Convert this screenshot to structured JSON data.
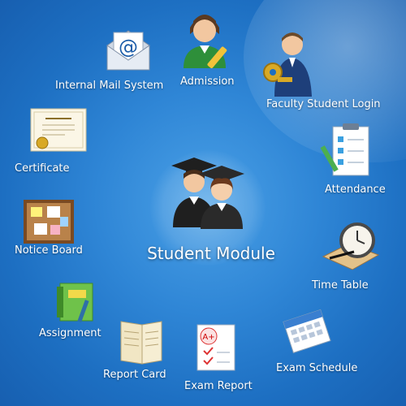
{
  "center": {
    "label": "Student Module",
    "icon": "graduates-icon"
  },
  "modules": [
    {
      "id": "mail",
      "label": "Internal Mail System",
      "icon": "mail-icon"
    },
    {
      "id": "admission",
      "label": "Admission",
      "icon": "student-pencil-icon"
    },
    {
      "id": "faculty",
      "label": "Faculty Student Login",
      "icon": "key-person-icon"
    },
    {
      "id": "certificate",
      "label": "Certificate",
      "icon": "certificate-icon"
    },
    {
      "id": "attendance",
      "label": "Attendance",
      "icon": "checklist-icon"
    },
    {
      "id": "notice",
      "label": "Notice Board",
      "icon": "corkboard-icon"
    },
    {
      "id": "timetable",
      "label": "Time Table",
      "icon": "clock-book-icon"
    },
    {
      "id": "assignment",
      "label": "Assignment",
      "icon": "notebook-icon"
    },
    {
      "id": "reportcard",
      "label": "Report Card",
      "icon": "report-card-icon"
    },
    {
      "id": "examreport",
      "label": "Exam Report",
      "icon": "exam-report-icon"
    },
    {
      "id": "examschedule",
      "label": "Exam Schedule",
      "icon": "calendar-icon"
    }
  ]
}
